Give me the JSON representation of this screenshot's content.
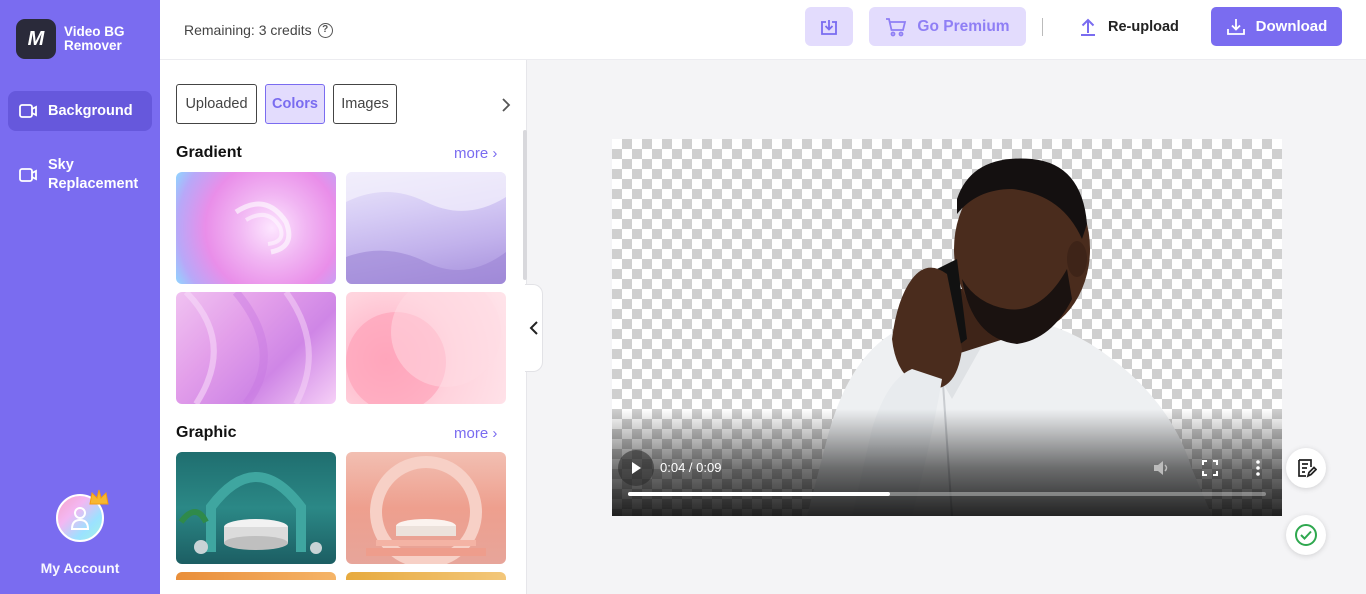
{
  "sidebar": {
    "logo_text": "Video BG Remover",
    "logo_glyph": "M",
    "items": [
      {
        "label": "Background",
        "icon": "video-icon",
        "active": true
      },
      {
        "label": "Sky Replacement",
        "icon": "video-icon",
        "active": false
      }
    ],
    "account_label": "My Account",
    "accent_color": "#7a6cf0"
  },
  "topbar": {
    "credits": "Remaining: 3 credits",
    "help_glyph": "?",
    "premium_label": "Go Premium",
    "reupload_label": "Re-upload",
    "download_label": "Download"
  },
  "panel": {
    "tabs": [
      {
        "label": "Uploaded",
        "active": false
      },
      {
        "label": "Colors",
        "active": true
      },
      {
        "label": "Images",
        "active": false
      }
    ],
    "sections": [
      {
        "title": "Gradient",
        "more": "more ›"
      },
      {
        "title": "Graphic",
        "more": "more ›"
      }
    ]
  },
  "player": {
    "time": "0:04 / 0:09",
    "progress": 0.41
  }
}
